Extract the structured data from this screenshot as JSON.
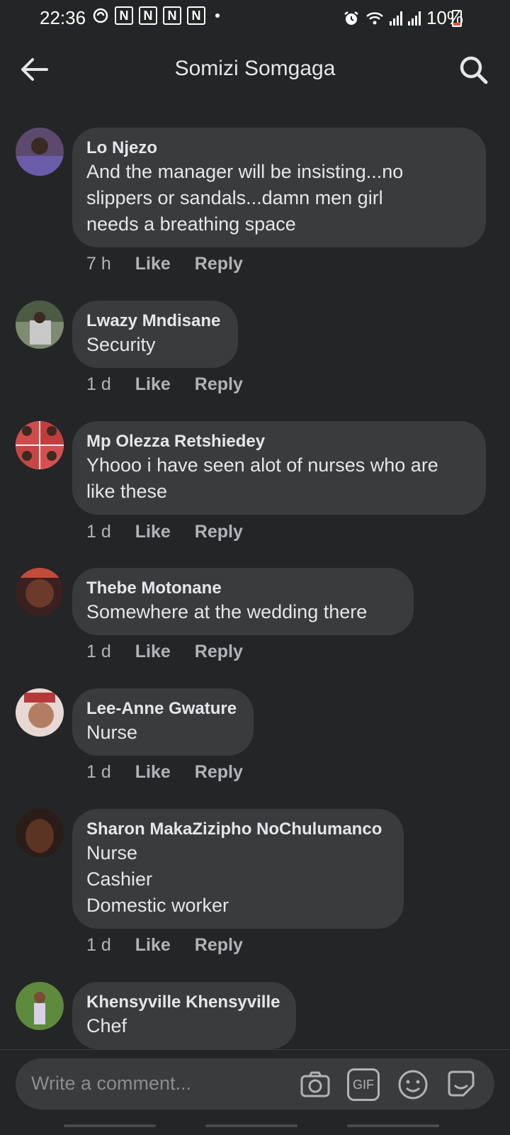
{
  "status_bar": {
    "time": "22:36",
    "notification_letter": "N",
    "battery": "10%"
  },
  "header": {
    "title": "Somizi Somgaga",
    "back_icon": "arrow-left-icon",
    "search_icon": "search-icon"
  },
  "comments": [
    {
      "author": "Lo Njezo",
      "text": "And the manager will be insisting...no\nslippers or sandals...damn men girl\nneeds a breathing space",
      "time": "7 h",
      "like": "Like",
      "reply": "Reply"
    },
    {
      "author": "Lwazy Mndisane",
      "text": "Security",
      "time": "1 d",
      "like": "Like",
      "reply": "Reply"
    },
    {
      "author": "Mp Olezza Retshiedey",
      "text": "Yhooo i have seen alot of nurses who are\nlike these",
      "time": "1 d",
      "like": "Like",
      "reply": "Reply"
    },
    {
      "author": "Thebe Motonane",
      "text": "Somewhere at the wedding there",
      "time": "1 d",
      "like": "Like",
      "reply": "Reply"
    },
    {
      "author": "Lee-Anne Gwature",
      "text": "Nurse",
      "time": "1 d",
      "like": "Like",
      "reply": "Reply"
    },
    {
      "author": "Sharon MakaZizipho NoChulumanco",
      "text": "Nurse\nCashier\nDomestic worker",
      "time": "1 d",
      "like": "Like",
      "reply": "Reply"
    },
    {
      "author": "Khensyville Khensyville",
      "text": "Chef"
    }
  ],
  "composer": {
    "placeholder": "Write a comment...",
    "icons": [
      "camera-icon",
      "gif-icon",
      "emoji-icon",
      "sticker-icon"
    ],
    "gif_label": "GIF"
  }
}
